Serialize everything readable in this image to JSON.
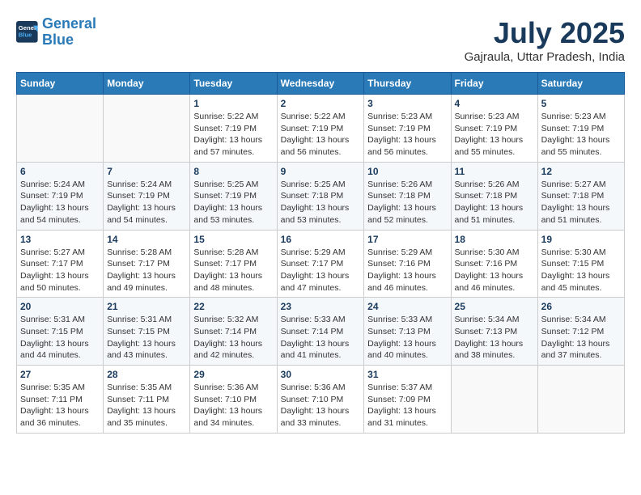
{
  "logo": {
    "line1": "General",
    "line2": "Blue"
  },
  "title": {
    "month_year": "July 2025",
    "location": "Gajraula, Uttar Pradesh, India"
  },
  "days_of_week": [
    "Sunday",
    "Monday",
    "Tuesday",
    "Wednesday",
    "Thursday",
    "Friday",
    "Saturday"
  ],
  "weeks": [
    [
      {
        "day": "",
        "info": ""
      },
      {
        "day": "",
        "info": ""
      },
      {
        "day": "1",
        "info": "Sunrise: 5:22 AM\nSunset: 7:19 PM\nDaylight: 13 hours\nand 57 minutes."
      },
      {
        "day": "2",
        "info": "Sunrise: 5:22 AM\nSunset: 7:19 PM\nDaylight: 13 hours\nand 56 minutes."
      },
      {
        "day": "3",
        "info": "Sunrise: 5:23 AM\nSunset: 7:19 PM\nDaylight: 13 hours\nand 56 minutes."
      },
      {
        "day": "4",
        "info": "Sunrise: 5:23 AM\nSunset: 7:19 PM\nDaylight: 13 hours\nand 55 minutes."
      },
      {
        "day": "5",
        "info": "Sunrise: 5:23 AM\nSunset: 7:19 PM\nDaylight: 13 hours\nand 55 minutes."
      }
    ],
    [
      {
        "day": "6",
        "info": "Sunrise: 5:24 AM\nSunset: 7:19 PM\nDaylight: 13 hours\nand 54 minutes."
      },
      {
        "day": "7",
        "info": "Sunrise: 5:24 AM\nSunset: 7:19 PM\nDaylight: 13 hours\nand 54 minutes."
      },
      {
        "day": "8",
        "info": "Sunrise: 5:25 AM\nSunset: 7:19 PM\nDaylight: 13 hours\nand 53 minutes."
      },
      {
        "day": "9",
        "info": "Sunrise: 5:25 AM\nSunset: 7:18 PM\nDaylight: 13 hours\nand 53 minutes."
      },
      {
        "day": "10",
        "info": "Sunrise: 5:26 AM\nSunset: 7:18 PM\nDaylight: 13 hours\nand 52 minutes."
      },
      {
        "day": "11",
        "info": "Sunrise: 5:26 AM\nSunset: 7:18 PM\nDaylight: 13 hours\nand 51 minutes."
      },
      {
        "day": "12",
        "info": "Sunrise: 5:27 AM\nSunset: 7:18 PM\nDaylight: 13 hours\nand 51 minutes."
      }
    ],
    [
      {
        "day": "13",
        "info": "Sunrise: 5:27 AM\nSunset: 7:17 PM\nDaylight: 13 hours\nand 50 minutes."
      },
      {
        "day": "14",
        "info": "Sunrise: 5:28 AM\nSunset: 7:17 PM\nDaylight: 13 hours\nand 49 minutes."
      },
      {
        "day": "15",
        "info": "Sunrise: 5:28 AM\nSunset: 7:17 PM\nDaylight: 13 hours\nand 48 minutes."
      },
      {
        "day": "16",
        "info": "Sunrise: 5:29 AM\nSunset: 7:17 PM\nDaylight: 13 hours\nand 47 minutes."
      },
      {
        "day": "17",
        "info": "Sunrise: 5:29 AM\nSunset: 7:16 PM\nDaylight: 13 hours\nand 46 minutes."
      },
      {
        "day": "18",
        "info": "Sunrise: 5:30 AM\nSunset: 7:16 PM\nDaylight: 13 hours\nand 46 minutes."
      },
      {
        "day": "19",
        "info": "Sunrise: 5:30 AM\nSunset: 7:15 PM\nDaylight: 13 hours\nand 45 minutes."
      }
    ],
    [
      {
        "day": "20",
        "info": "Sunrise: 5:31 AM\nSunset: 7:15 PM\nDaylight: 13 hours\nand 44 minutes."
      },
      {
        "day": "21",
        "info": "Sunrise: 5:31 AM\nSunset: 7:15 PM\nDaylight: 13 hours\nand 43 minutes."
      },
      {
        "day": "22",
        "info": "Sunrise: 5:32 AM\nSunset: 7:14 PM\nDaylight: 13 hours\nand 42 minutes."
      },
      {
        "day": "23",
        "info": "Sunrise: 5:33 AM\nSunset: 7:14 PM\nDaylight: 13 hours\nand 41 minutes."
      },
      {
        "day": "24",
        "info": "Sunrise: 5:33 AM\nSunset: 7:13 PM\nDaylight: 13 hours\nand 40 minutes."
      },
      {
        "day": "25",
        "info": "Sunrise: 5:34 AM\nSunset: 7:13 PM\nDaylight: 13 hours\nand 38 minutes."
      },
      {
        "day": "26",
        "info": "Sunrise: 5:34 AM\nSunset: 7:12 PM\nDaylight: 13 hours\nand 37 minutes."
      }
    ],
    [
      {
        "day": "27",
        "info": "Sunrise: 5:35 AM\nSunset: 7:11 PM\nDaylight: 13 hours\nand 36 minutes."
      },
      {
        "day": "28",
        "info": "Sunrise: 5:35 AM\nSunset: 7:11 PM\nDaylight: 13 hours\nand 35 minutes."
      },
      {
        "day": "29",
        "info": "Sunrise: 5:36 AM\nSunset: 7:10 PM\nDaylight: 13 hours\nand 34 minutes."
      },
      {
        "day": "30",
        "info": "Sunrise: 5:36 AM\nSunset: 7:10 PM\nDaylight: 13 hours\nand 33 minutes."
      },
      {
        "day": "31",
        "info": "Sunrise: 5:37 AM\nSunset: 7:09 PM\nDaylight: 13 hours\nand 31 minutes."
      },
      {
        "day": "",
        "info": ""
      },
      {
        "day": "",
        "info": ""
      }
    ]
  ]
}
